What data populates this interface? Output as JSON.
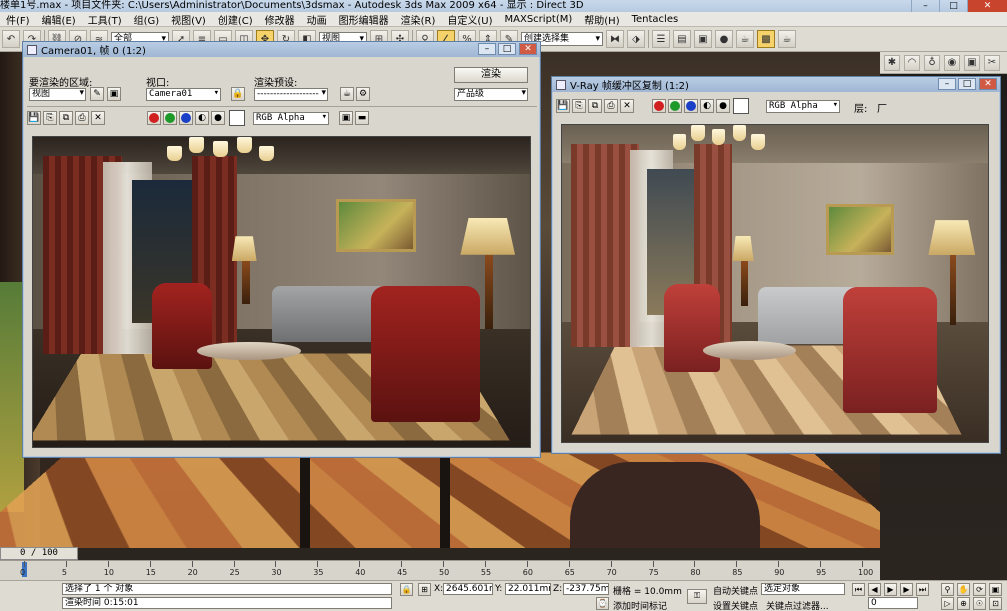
{
  "app": {
    "title": "楼单1号.max    - 项目文件夹: C:\\Users\\Administrator\\Documents\\3dsmax    - Autodesk 3ds Max  2009 x64    - 显示 : Direct 3D"
  },
  "menu": {
    "items": [
      "件(F)",
      "编辑(E)",
      "工具(T)",
      "组(G)",
      "视图(V)",
      "创建(C)",
      "修改器",
      "动画",
      "图形编辑器",
      "渲染(R)",
      "自定义(U)",
      "MAXScript(M)",
      "帮助(H)",
      "Tentacles"
    ]
  },
  "toolbar": {
    "selection_filter": "全部",
    "view_select": "视图",
    "named_selection": "创建选择集"
  },
  "camera_window": {
    "title": "Camera01, 帧 0 (1:2)",
    "area_label": "要渲染的区域:",
    "area_value": "视图",
    "viewport_label": "视口:",
    "viewport_value": "Camera01",
    "preset_label": "渲染预设:",
    "preset_value": "-------------------",
    "render_button": "渲染",
    "quality_value": "产品级",
    "channel_value": "RGB Alpha"
  },
  "vray_window": {
    "title": "V-Ray 帧缓冲区复制 (1:2)",
    "channel_value": "RGB Alpha",
    "layer_label": "层:",
    "layer_value": "厂"
  },
  "viewport": {
    "frame_counter": "0 / 100"
  },
  "timeline": {
    "ticks": [
      "0",
      "5",
      "10",
      "15",
      "20",
      "25",
      "30",
      "35",
      "40",
      "45",
      "50",
      "55",
      "60",
      "65",
      "70",
      "75",
      "80",
      "85",
      "90",
      "95",
      "100"
    ]
  },
  "status": {
    "selected": "选择了 1 个 对象",
    "render_time": "渲染时间  0:15:01",
    "x_label": "X:",
    "x_value": "2645.601m",
    "y_label": "Y:",
    "y_value": "22.011mm",
    "z_label": "Z:",
    "z_value": "-237.75mm",
    "grid": "栅格 = 10.0mm",
    "add_time_tag": "添加时间标记",
    "auto_key": "自动关键点",
    "auto_key_value": "选定对象",
    "set_key": "设置关键点",
    "key_filters": "关键点过滤器...",
    "current_frame": "0"
  },
  "colors": {
    "title_bar": "#b9cde4",
    "panel": "#dedbd3",
    "accent_yellow": "#f6d36a"
  }
}
